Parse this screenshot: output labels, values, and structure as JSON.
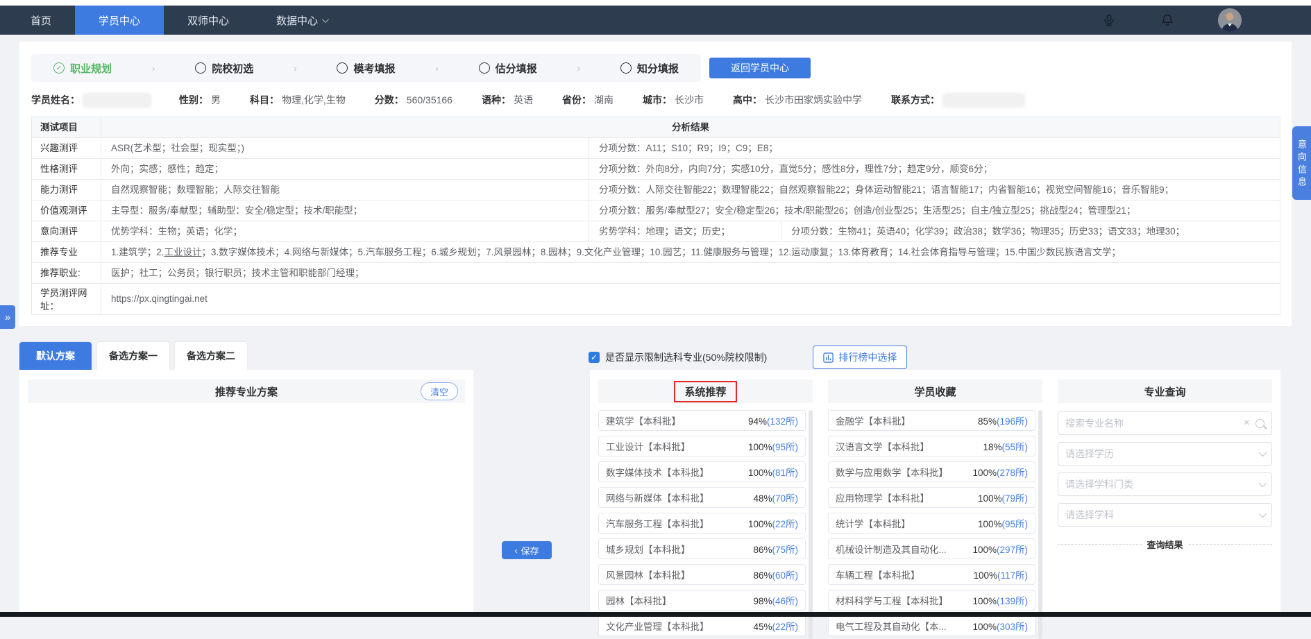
{
  "colors": {
    "accent_blue": "#3e7be0",
    "link_blue": "#4a7fe0",
    "nav_bg": "#2e3c50",
    "step_green": "#58b666",
    "highlight_red": "#e12b2b"
  },
  "icons": {
    "check": "✓",
    "step_separator": "›",
    "close": "×",
    "chevron_left": "‹",
    "expand": "»"
  },
  "nav": {
    "items": [
      {
        "label": "首页"
      },
      {
        "label": "学员中心"
      },
      {
        "label": "双师中心"
      },
      {
        "label": "数据中心"
      }
    ]
  },
  "steps": {
    "items": [
      {
        "label": "职业规划"
      },
      {
        "label": "院校初选"
      },
      {
        "label": "模考填报"
      },
      {
        "label": "估分填报"
      },
      {
        "label": "知分填报"
      }
    ],
    "return_button": "返回学员中心"
  },
  "student": {
    "fields": [
      {
        "label": "学员姓名：",
        "value": ""
      },
      {
        "label": "性别：",
        "value": "男"
      },
      {
        "label": "科目：",
        "value": "物理,化学,生物"
      },
      {
        "label": "分数：",
        "value": "560/35166"
      },
      {
        "label": "语种：",
        "value": "英语"
      },
      {
        "label": "省份：",
        "value": "湖南"
      },
      {
        "label": "城市：",
        "value": "长沙市"
      },
      {
        "label": "高中：",
        "value": "长沙市田家炳实验中学"
      },
      {
        "label": "联系方式：",
        "value": ""
      }
    ]
  },
  "table": {
    "header": {
      "col1": "测试项目",
      "col2": "分析结果"
    },
    "rows": [
      {
        "label": "兴趣测评",
        "a": "ASR(艺术型；社会型；现实型；)",
        "b": "分项分数：A11；S10；R9；I9；C9；E8；"
      },
      {
        "label": "性格测评",
        "a": "外向；实感；感性；趋定；",
        "b": "分项分数：外向8分，内向7分；实感10分，直觉5分；感性8分，理性7分；趋定9分，顺变6分；"
      },
      {
        "label": "能力测评",
        "a": "自然观察智能；数理智能；人际交往智能",
        "b": "分项分数：人际交往智能22；数理智能22；自然观察智能22；身体运动智能21；语言智能17；内省智能16；视觉空间智能16；音乐智能9；"
      },
      {
        "label": "价值观测评",
        "a": "主导型：服务/奉献型；辅助型：安全/稳定型；技术/职能型；",
        "b": "分项分数：服务/奉献型27；安全/稳定型26；技术/职能型26；创造/创业型25；生活型25；自主/独立型25；挑战型24；管理型21；"
      },
      {
        "label": "意向测评",
        "a": "优势学科：生物；英语；化学；",
        "b": "劣势学科：地理；语文；历史；",
        "c": "分项分数：生物41；英语40；化学39；政治38；数学36；物理35；历史33；语文33；地理30；"
      },
      {
        "label": "推荐专业",
        "a_prefix": "1.建筑学；2.",
        "a_underlined": "工业设计",
        "a_suffix": "；3.数字媒体技术；4.网络与新媒体；5.汽车服务工程；6.城乡规划；7.风景园林；8.园林；9.文化产业管理；10.园艺；11.健康服务与管理；12.运动康复；13.体育教育；14.社会体育指导与管理；15.中国少数民族语言文学；"
      },
      {
        "label": "推荐职业:",
        "a": "医护；社工；公务员；银行职员；技术主管和职能部门经理；"
      },
      {
        "label": "学员测评网址：",
        "a": "https://px.qingtingai.net"
      }
    ]
  },
  "plans": {
    "tabs": [
      {
        "label": "默认方案"
      },
      {
        "label": "备选方案一"
      },
      {
        "label": "备选方案二"
      }
    ],
    "checkbox_label": "是否显示限制选科专业(50%院校限制)",
    "rank_button": "排行榜中选择"
  },
  "left_panel": {
    "title": "推荐专业方案",
    "clear_button": "清空",
    "save_button": "保存"
  },
  "columns": {
    "system": {
      "title": "系统推荐",
      "items": [
        {
          "name": "建筑学【本科批】",
          "percent": "94%",
          "count": "(132所)"
        },
        {
          "name": "工业设计【本科批】",
          "percent": "100%",
          "count": "(95所)"
        },
        {
          "name": "数字媒体技术【本科批】",
          "percent": "100%",
          "count": "(81所)"
        },
        {
          "name": "网络与新媒体【本科批】",
          "percent": "48%",
          "count": "(70所)"
        },
        {
          "name": "汽车服务工程【本科批】",
          "percent": "100%",
          "count": "(22所)"
        },
        {
          "name": "城乡规划【本科批】",
          "percent": "86%",
          "count": "(75所)"
        },
        {
          "name": "风景园林【本科批】",
          "percent": "86%",
          "count": "(60所)"
        },
        {
          "name": "园林【本科批】",
          "percent": "98%",
          "count": "(46所)"
        },
        {
          "name": "文化产业管理【本科批】",
          "percent": "45%",
          "count": "(22所)"
        }
      ]
    },
    "favorites": {
      "title": "学员收藏",
      "items": [
        {
          "name": "金融学【本科批】",
          "percent": "85%",
          "count": "(196所)"
        },
        {
          "name": "汉语言文学【本科批】",
          "percent": "18%",
          "count": "(55所)"
        },
        {
          "name": "数学与应用数学【本科批】",
          "percent": "100%",
          "count": "(278所)"
        },
        {
          "name": "应用物理学【本科批】",
          "percent": "100%",
          "count": "(79所)"
        },
        {
          "name": "统计学【本科批】",
          "percent": "100%",
          "count": "(95所)"
        },
        {
          "name": "机械设计制造及其自动化...",
          "percent": "100%",
          "count": "(297所)"
        },
        {
          "name": "车辆工程【本科批】",
          "percent": "100%",
          "count": "(117所)"
        },
        {
          "name": "材料科学与工程【本科批】",
          "percent": "100%",
          "count": "(139所)"
        },
        {
          "name": "电气工程及其自动化【本...",
          "percent": "100%",
          "count": "(303所)"
        }
      ]
    },
    "query": {
      "title": "专业查询",
      "search_placeholder": "搜索专业名称",
      "selects": [
        "请选择学历",
        "请选择学科门类",
        "请选择学科"
      ],
      "result_divider": "查询结果"
    }
  },
  "floating": {
    "side_tab": "意向信息"
  }
}
